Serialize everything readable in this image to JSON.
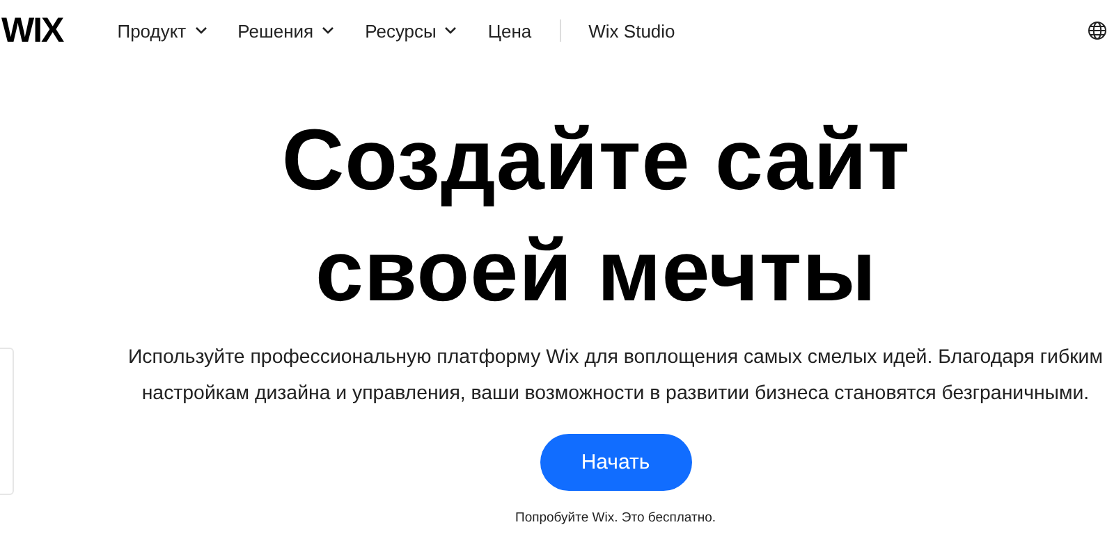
{
  "header": {
    "logo": "WIX",
    "nav": [
      {
        "label": "Продукт",
        "dropdown": true
      },
      {
        "label": "Решения",
        "dropdown": true
      },
      {
        "label": "Ресурсы",
        "dropdown": true
      },
      {
        "label": "Цена",
        "dropdown": false
      }
    ],
    "studio_link": "Wix Studio"
  },
  "hero": {
    "headline": "Создайте сайт\nсвоей мечты",
    "description": "Используйте профессиональную платформу Wix для воплощения самых смелых идей. Благодаря гибким\nнастройкам дизайна и управления, ваши возможности в развитии бизнеса становятся безграничными.",
    "button": "Начать",
    "note": "Попробуйте Wix. Это бесплатно."
  }
}
